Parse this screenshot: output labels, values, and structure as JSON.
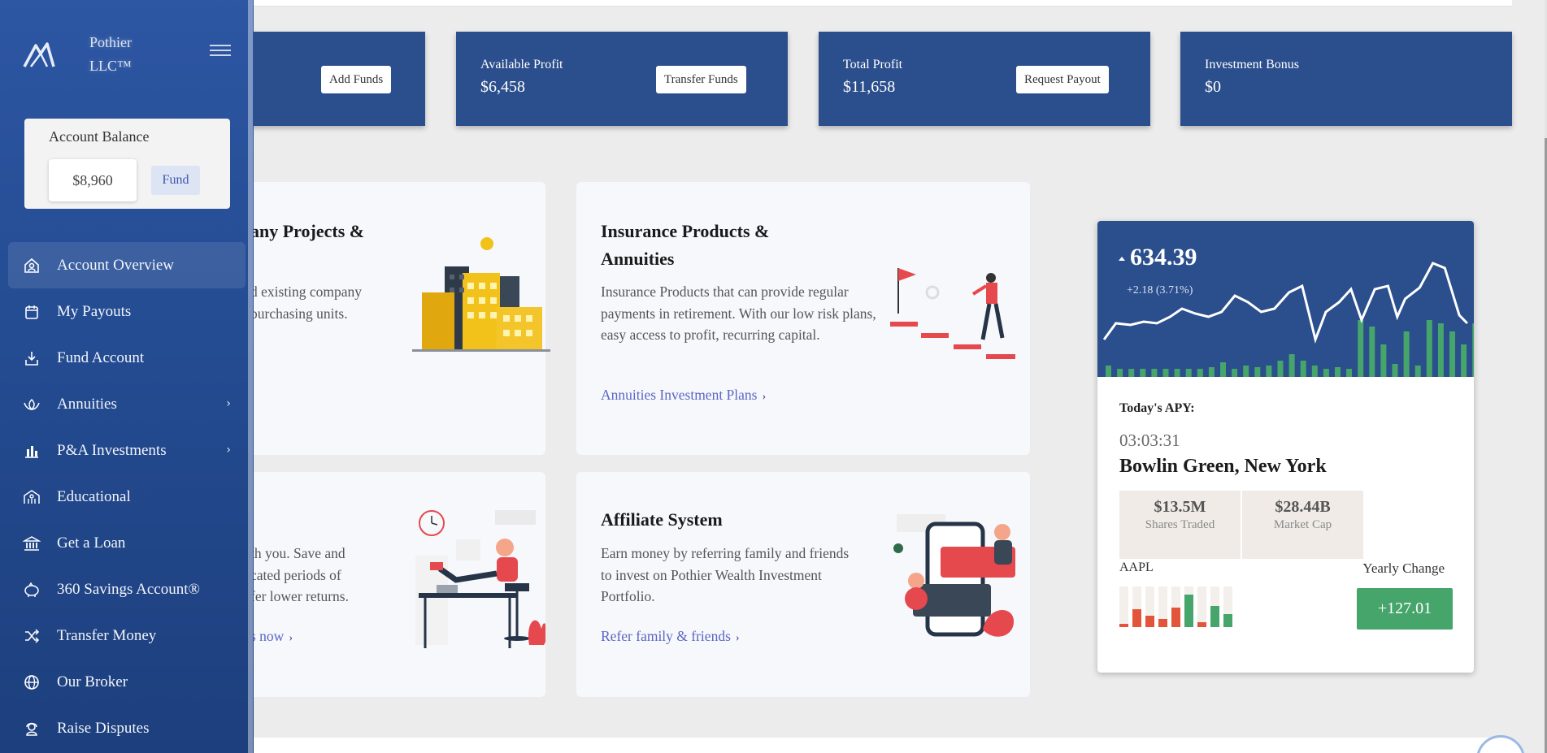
{
  "stats": [
    {
      "label": "",
      "value": "",
      "button": "Add Funds"
    },
    {
      "label": "Available Profit",
      "value": "$6,458",
      "button": "Transfer Funds"
    },
    {
      "label": "Total Profit",
      "value": "$11,658",
      "button": "Request Payout"
    },
    {
      "label": "Investment Bonus",
      "value": "$0",
      "button": ""
    }
  ],
  "features": [
    {
      "title": "any Projects &",
      "text": "d existing company\npurchasing units.",
      "link": ""
    },
    {
      "title": "Insurance Products & Annuities",
      "text": "Insurance Products that can provide regular payments in retirement. With our low risk plans, easy access to profit, recurring capital.",
      "link": "Annuities Investment Plans"
    },
    {
      "title": "",
      "text": "th you. Save and\ncated periods of\nfer lower returns.",
      "link": "s now"
    },
    {
      "title": "Affiliate System",
      "text": "Earn money by referring family and friends to invest on Pothier Wealth Investment Portfolio.",
      "link": "Refer family & friends"
    }
  ],
  "ticker": {
    "price": "634.39",
    "delta": "+2.18 (3.71%)",
    "apy_label": "Today's APY:",
    "time": "03:03:31",
    "location": "Bowlin Green, New York",
    "shares_traded_value": "$13.5M",
    "shares_traded_label": "Shares Traded",
    "market_cap_value": "$28.44B",
    "market_cap_label": "Market Cap",
    "symbol": "AAPL",
    "yearly_label": "Yearly Change",
    "yearly_value": "+127.01",
    "up_color": "#46a56b",
    "down_color": "#e2553a"
  },
  "sidebar": {
    "brand": "Pothier LLC™",
    "balance_title": "Account Balance",
    "balance_value": "$8,960",
    "fund_label": "Fund",
    "items": [
      {
        "label": "Account Overview",
        "icon": "home-user-icon",
        "active": true,
        "chevron": false
      },
      {
        "label": "My Payouts",
        "icon": "calendar-icon",
        "active": false,
        "chevron": false
      },
      {
        "label": "Fund Account",
        "icon": "deposit-icon",
        "active": false,
        "chevron": false
      },
      {
        "label": "Annuities",
        "icon": "lotus-icon",
        "active": false,
        "chevron": true
      },
      {
        "label": "P&A Investments",
        "icon": "bar-chart-icon",
        "active": false,
        "chevron": true
      },
      {
        "label": "Educational",
        "icon": "people-icon",
        "active": false,
        "chevron": false
      },
      {
        "label": "Get a Loan",
        "icon": "bank-icon",
        "active": false,
        "chevron": false
      },
      {
        "label": "360 Savings Account®",
        "icon": "piggy-bank-icon",
        "active": false,
        "chevron": false
      },
      {
        "label": "Transfer Money",
        "icon": "shuffle-icon",
        "active": false,
        "chevron": false
      },
      {
        "label": "Our Broker",
        "icon": "globe-icon",
        "active": false,
        "chevron": false
      },
      {
        "label": "Raise Disputes",
        "icon": "support-agent-icon",
        "active": false,
        "chevron": false
      }
    ]
  },
  "colors": {
    "primary": "#2b4e8d",
    "sidebar": "#244c92",
    "link": "#5a66c4",
    "accent_red": "#e5484d",
    "accent_yellow": "#f2c21b"
  }
}
